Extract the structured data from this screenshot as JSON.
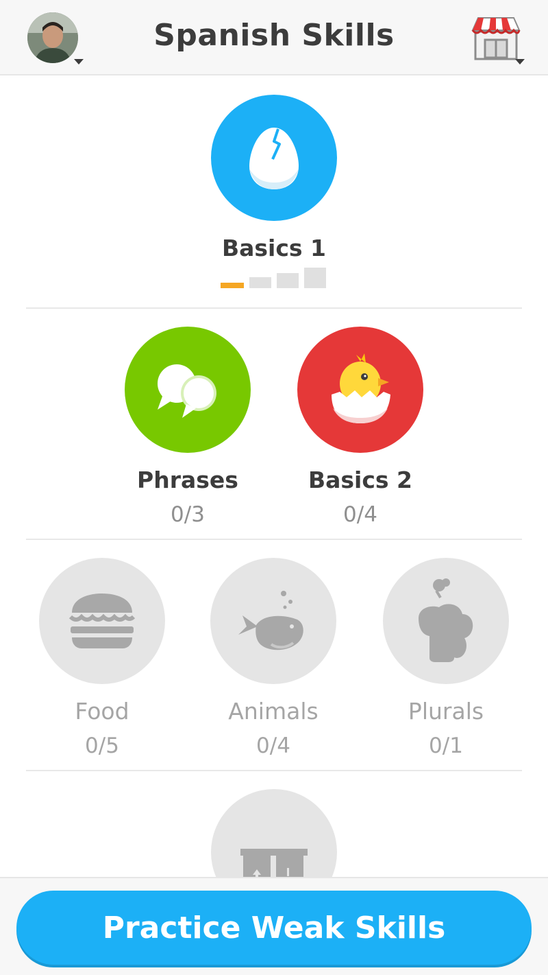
{
  "header": {
    "title": "Spanish Skills",
    "avatar_icon": "user-avatar",
    "shop_icon": "shop-icon"
  },
  "skills": {
    "basics1": {
      "name": "Basics 1",
      "icon": "cracked-egg-icon",
      "color": "#1cb0f6",
      "strength_level": 1,
      "strength_max": 4
    },
    "phrases": {
      "name": "Phrases",
      "progress": "0/3",
      "icon": "speech-bubbles-icon",
      "color": "#78c800"
    },
    "basics2": {
      "name": "Basics 2",
      "progress": "0/4",
      "icon": "hatching-chick-icon",
      "color": "#e53838"
    },
    "food": {
      "name": "Food",
      "progress": "0/5",
      "icon": "burger-icon",
      "color": "#e5e5e5",
      "locked": true
    },
    "animals": {
      "name": "Animals",
      "progress": "0/4",
      "icon": "whale-icon",
      "color": "#e5e5e5",
      "locked": true
    },
    "plurals": {
      "name": "Plurals",
      "progress": "0/1",
      "icon": "plurals-icon",
      "color": "#e5e5e5",
      "locked": true
    },
    "next": {
      "icon": "door-icon",
      "color": "#e5e5e5",
      "locked": true
    }
  },
  "footer": {
    "practice_label": "Practice Weak Skills",
    "button_color": "#1cb0f6"
  }
}
